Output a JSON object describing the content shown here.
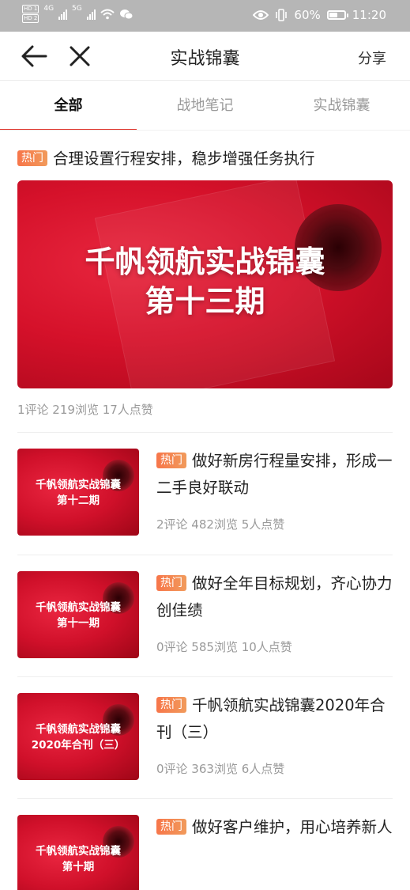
{
  "status_bar": {
    "hd1": "HD 1",
    "hd2": "HD 2",
    "net1": "4G",
    "net2": "5G",
    "battery_percent_text": "60%",
    "battery_level": 0.6,
    "time": "11:20",
    "icons": [
      "eye-icon",
      "vibrate-icon",
      "wifi-icon",
      "wechat-icon"
    ]
  },
  "nav": {
    "title": "实战锦囊",
    "share_label": "分享"
  },
  "tabs": [
    {
      "label": "全部",
      "active": true
    },
    {
      "label": "战地笔记",
      "active": false
    },
    {
      "label": "实战锦囊",
      "active": false
    }
  ],
  "hot_label": "热门",
  "featured": {
    "title": "合理设置行程安排，稳步增强任务执行",
    "banner_line1": "千帆领航实战锦囊",
    "banner_line2": "第十三期",
    "stats": "1评论  219浏览  17人点赞"
  },
  "items": [
    {
      "title": "做好新房行程量安排，形成一二手良好联动",
      "thumb_line1": "千帆领航实战锦囊",
      "thumb_line2": "第十二期",
      "stats": "2评论  482浏览  5人点赞"
    },
    {
      "title": "做好全年目标规划，齐心协力创佳绩",
      "thumb_line1": "千帆领航实战锦囊",
      "thumb_line2": "第十一期",
      "stats": "0评论  585浏览  10人点赞"
    },
    {
      "title": "千帆领航实战锦囊2020年合刊（三）",
      "thumb_line1": "千帆领航实战锦囊",
      "thumb_line2": "2020年合刊（三）",
      "stats": "0评论  363浏览  6人点赞"
    },
    {
      "title": "做好客户维护，用心培养新人",
      "thumb_line1": "千帆领航实战锦囊",
      "thumb_line2": "第十期",
      "stats": ""
    }
  ],
  "colors": {
    "accent": "#e0342b",
    "hot_badge": "#f48050",
    "status_bar": "#b6b6b6"
  }
}
